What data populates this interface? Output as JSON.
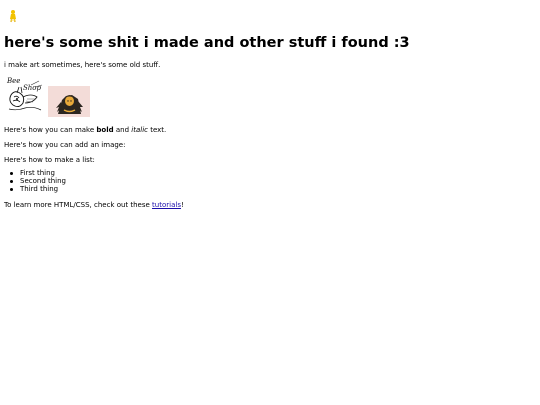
{
  "header": {
    "title": "here's some shit i made and other stuff i found :3",
    "subtitle": "i make art sometimes, here's some old stuff."
  },
  "gallery": {
    "image1_alt": "Bee Shop drawing",
    "image1_text_line1": "Bee",
    "image1_text_line2": "Shop",
    "image2_alt": "character art"
  },
  "content": {
    "bold_line_prefix": "Here's how you can make ",
    "bold_word": "bold",
    "bold_line_middle": " and ",
    "italic_word": "italic",
    "bold_line_suffix": " text.",
    "image_line": "Here's how you can add an image:",
    "list_intro": "Here's how to make a list:",
    "list_items": [
      "First thing",
      "Second thing",
      "Third thing"
    ],
    "learn_prefix": "To learn more HTML/CSS, check out these ",
    "learn_link": "tutorials",
    "learn_suffix": "!"
  },
  "colors": {
    "link": "#1a0dab",
    "art_bg": "#f3dcd8",
    "icon": "#f2c200"
  },
  "icons": {
    "corner": "figure-icon"
  }
}
